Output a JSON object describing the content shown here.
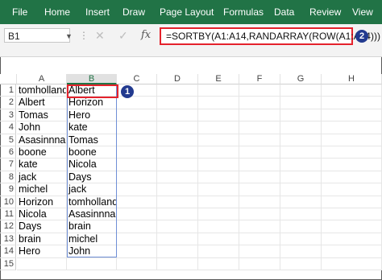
{
  "ribbon": {
    "tabs": [
      "File",
      "Home",
      "Insert",
      "Draw",
      "Page Layout",
      "Formulas",
      "Data",
      "Review",
      "View"
    ]
  },
  "formula_bar": {
    "name_box": "B1",
    "cancel_icon": "close-icon",
    "enter_icon": "check-icon",
    "fx_label": "fx",
    "formula": "=SORTBY(A1:A14,RANDARRAY(ROW(A1:A14)))"
  },
  "annotations": {
    "badge1": "1",
    "badge2": "2"
  },
  "sheet": {
    "columns": [
      "A",
      "B",
      "C",
      "D",
      "E",
      "F",
      "G",
      "H"
    ],
    "rows": [
      "1",
      "2",
      "3",
      "4",
      "5",
      "6",
      "7",
      "8",
      "9",
      "10",
      "11",
      "12",
      "13",
      "14",
      "15"
    ],
    "col_a": [
      "tomholland",
      "Albert",
      "Tomas",
      "John",
      "Asasinnna",
      "boone",
      "kate",
      "jack",
      "michel",
      "Horizon",
      "Nicola",
      "Days",
      "brain",
      "Hero"
    ],
    "col_b": [
      "Albert",
      "Horizon",
      "Hero",
      "kate",
      "Tomas",
      "boone",
      "Nicola",
      "Days",
      "jack",
      "tomholland",
      "Asasinnna",
      "brain",
      "michel",
      "John"
    ],
    "active_cell": "B1"
  },
  "colors": {
    "ribbon": "#217346",
    "highlight": "#e4222c",
    "badge": "#223a8f"
  }
}
